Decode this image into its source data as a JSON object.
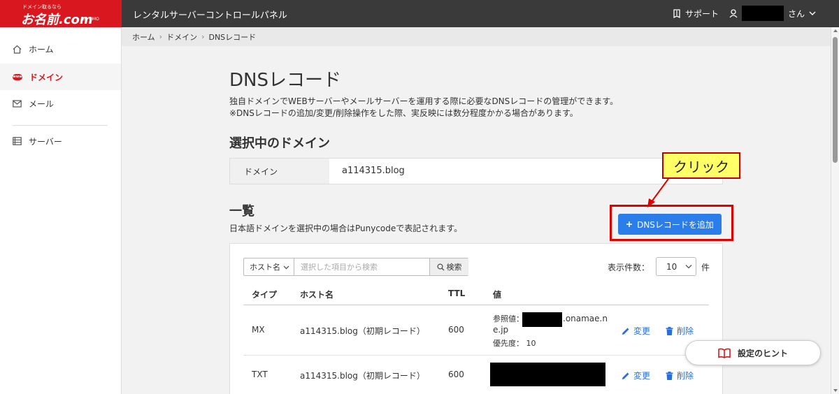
{
  "header": {
    "logo_tagline": "ドメイン取るなら",
    "logo_text": "お名前.com",
    "logo_sub": "by GMO",
    "app_title": "レンタルサーバーコントロールパネル",
    "support_label": "サポート",
    "user_suffix": "さん"
  },
  "sidebar": {
    "items": [
      {
        "label": "ホーム",
        "icon": "home-icon"
      },
      {
        "label": "ドメイン",
        "icon": "domain-badge-icon",
        "active": true,
        "badge": "www"
      },
      {
        "label": "メール",
        "icon": "mail-icon"
      },
      {
        "label": "サーバー",
        "icon": "server-icon"
      }
    ]
  },
  "breadcrumb": [
    "ホーム",
    "ドメイン",
    "DNSレコード"
  ],
  "page": {
    "title": "DNSレコード",
    "desc1": "独自ドメインでWEBサーバーやメールサーバーを運用する際に必要なDNSレコードの管理ができます。",
    "desc2": "※DNSレコードの追加/変更/削除操作をした際、実反映には数分程度かかる場合があります。"
  },
  "selected_domain": {
    "section_title": "選択中のドメイン",
    "label": "ドメイン",
    "value": "a114315.blog"
  },
  "list": {
    "section_title": "一覧",
    "note": "日本語ドメインを選択中の場合はPunycodeで表記されます。",
    "add_button": "DNSレコードを追加",
    "callout": "クリック",
    "search": {
      "select_label": "ホスト名",
      "placeholder": "選択した項目から検索",
      "button": "検索"
    },
    "count_label": "表示件数：",
    "count_value": "10",
    "count_unit": "件",
    "columns": [
      "タイプ",
      "ホスト名",
      "TTL",
      "値"
    ],
    "rows": [
      {
        "type": "MX",
        "host": "a114315.blog（初期レコード）",
        "ttl": "600",
        "ref_label": "参照値：",
        "ref_suffix": ".onamae.n",
        "ref_line2": "e.jp",
        "priority": "優先度： 10",
        "edit": "変更",
        "delete": "削除"
      },
      {
        "type": "TXT",
        "host": "a114315.blog（初期レコード）",
        "ttl": "600",
        "edit": "変更",
        "delete": "削除"
      }
    ]
  },
  "hint_button": "設定のヒント",
  "colors": {
    "brand_red": "#d8181e",
    "primary_blue": "#2b7de9",
    "topbar": "#3a3a3a",
    "callout_yellow": "#ffff66",
    "highlight_red": "#e00000"
  }
}
